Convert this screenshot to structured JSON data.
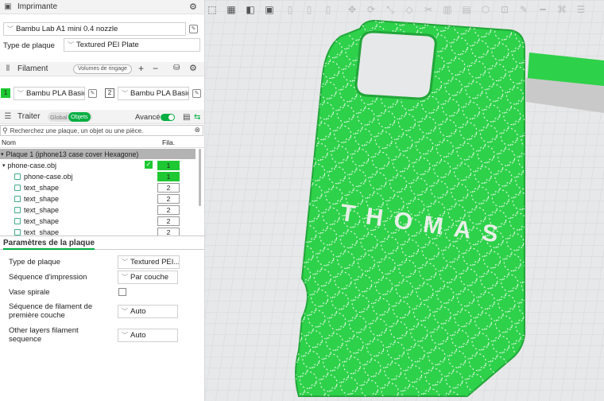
{
  "printer": {
    "title": "Imprimante",
    "name": "Bambu Lab A1 mini 0.4 nozzle",
    "plate_label": "Type de plaque",
    "plate_value": "Textured PEI Plate"
  },
  "filament": {
    "title": "Filament",
    "flush_label": "Volumes de ringage",
    "slots": [
      {
        "index": "1",
        "name": "Bambu PLA Basic",
        "color": "#1ec832"
      },
      {
        "index": "2",
        "name": "Bambu PLA Basic",
        "color": "#ffffff"
      }
    ]
  },
  "process": {
    "title": "Traiter",
    "tab_global": "Global",
    "tab_objects": "Objets",
    "advanced_label": "Avancé",
    "search_placeholder": "Recherchez une plaque, un objet ou une pièce."
  },
  "tree": {
    "col_name": "Nom",
    "col_fila": "Fila.",
    "plate": "Plaque 1 (iphone13 case cover Hexagone)",
    "rows": [
      {
        "name": "phone-case.obj",
        "fila": "1"
      },
      {
        "name": "phone-case.obj",
        "fila": "1"
      },
      {
        "name": "text_shape",
        "fila": "2"
      },
      {
        "name": "text_shape",
        "fila": "2"
      },
      {
        "name": "text_shape",
        "fila": "2"
      },
      {
        "name": "text_shape",
        "fila": "2"
      },
      {
        "name": "text_shape",
        "fila": "2"
      }
    ]
  },
  "plate_params": {
    "title": "Paramètres de la plaque",
    "items": [
      {
        "label": "Type de plaque",
        "value": "Textured PEI..."
      },
      {
        "label": "Séquence d'impression",
        "value": "Par couche"
      },
      {
        "label": "Vase spirale",
        "value": ""
      },
      {
        "label": "Séquence de filament de première couche",
        "value": "Auto"
      },
      {
        "label": "Other layers filament sequence",
        "value": "Auto"
      }
    ]
  },
  "viewport": {
    "model_text": "THOMAS",
    "model_color": "#2ed14a"
  }
}
